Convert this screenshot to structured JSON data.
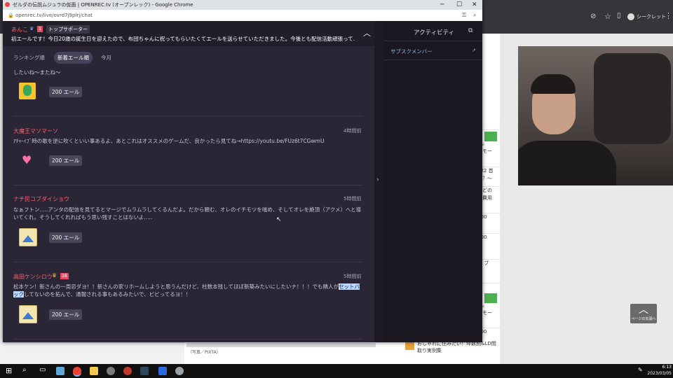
{
  "popup": {
    "window_title": "ゼルダの伝説ムジュラの仮面 | OPENREC.tv (オープンレック) - Google Chrome",
    "url": "openrec.tv/live/ovrd7j9plrj/chat"
  },
  "pinned": {
    "user": "あんこ",
    "badge_number": "1",
    "badge_label": "トップサポーター",
    "text": "初エールです！今日20歳の誕生日を迎えたので、布団ちゃんに祝ってもらいたくてエールを送らせていただきました。今後とも配信活動頑張って..."
  },
  "sort_tabs": [
    "ランキング順",
    "新着エール順",
    "今月"
  ],
  "entries": [
    {
      "name": "",
      "time": "",
      "text": "したいね～またね～",
      "amount": "200 エール"
    },
    {
      "name": "大魔王マソマーソ",
      "time": "4時間前",
      "text": "ｱﾁｬｰｲﾌﾞ時の歌を逆に吹くといい事あるよ、あとこれはオススメのゲームだ、良かったら見てね→https://youtu.be/FUz6t7CGwmU",
      "amount": "200 エール"
    },
    {
      "name": "ナチ民コブダイショウ",
      "time": "5時間前",
      "text": "なぁフトン.....アンタの配信を見てるとマージでムラムラしてくるんだよ。だから頼む、オレのイチモツを嗤め、そしてオレを絶頂（アクメ）へと導いてくれ。そうしてくれればもう思い残すことはないよ.....",
      "amount": "200 エール"
    },
    {
      "name": "高田ケンシロウ",
      "badge": "28",
      "time": "5時間前",
      "text_before": "松本ケン！新さんの一周忌ダヨ！！新さんの家リホームしようと思うんだけど、柱数本残してほぼ新築みたいにしたいナ！！！でも隣人が",
      "text_highlight": "セットバック",
      "text_after": "してないのを拓んで、通報される事もあるみたいで、ビビってるヨ！！",
      "amount": "200 エール"
    }
  ],
  "activity": {
    "title": "アクティビティ",
    "sub_member": "サブスクメンバー"
  },
  "background": {
    "profile_label": "シークレット",
    "photo_credit": "（写真／PIXTA）",
    "side_texts": [
      "り。",
      "スモー",
      "022 首",
      "は？～",
      "はどの",
      "ル費用",
      "200",
      "い",
      "200",
      "い",
      "？ ブ",
      "り。",
      "スモー",
      "200",
      "い"
    ],
    "bottom_text": "おしゃれに住みたい！坪数別&LD間取り実例集",
    "up_button_label": "ページの先頭へ"
  },
  "taskbar": {
    "time": "6:13",
    "date": "2023/03/05"
  },
  "colors": {
    "accent_name": "#ff5f6d",
    "highlight": "#b9d7ff",
    "panel": "#2a2636"
  }
}
